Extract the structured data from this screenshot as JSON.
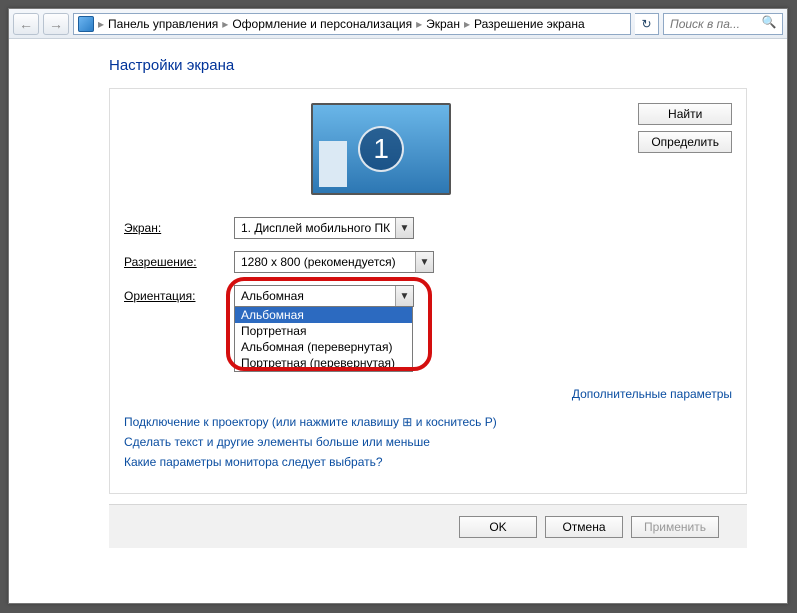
{
  "toolbar": {
    "breadcrumbs": [
      "Панель управления",
      "Оформление и персонализация",
      "Экран",
      "Разрешение экрана"
    ],
    "search_placeholder": "Поиск в па..."
  },
  "header": {
    "title": "Настройки экрана"
  },
  "preview": {
    "monitor_number": "1"
  },
  "side_buttons": {
    "find": "Найти",
    "detect": "Определить"
  },
  "form": {
    "screen": {
      "label_pre": "Э",
      "label_rest": "кран:",
      "value": "1. Дисплей мобильного ПК"
    },
    "resolution": {
      "label_pre": "Р",
      "label_rest": "азрешение:",
      "value": "1280 x 800 (рекомендуется)"
    },
    "orientation": {
      "label_pre": "О",
      "label_rest": "риентация:",
      "value": "Альбомная",
      "options": [
        "Альбомная",
        "Портретная",
        "Альбомная (перевернутая)",
        "Портретная (перевернутая)"
      ]
    }
  },
  "right_link": {
    "advanced": "Дополнительные параметры"
  },
  "links": {
    "projector": "Подключение к проектору (или нажмите клавишу ⊞ и коснитесь P)",
    "textsize": "Сделать текст и другие элементы больше или меньше",
    "which": "Какие параметры монитора следует выбрать?"
  },
  "footer": {
    "ok": "OK",
    "cancel": "Отмена",
    "apply": "Применить"
  }
}
